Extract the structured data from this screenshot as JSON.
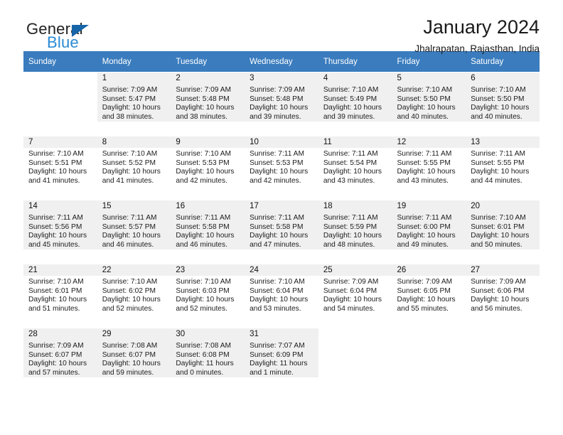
{
  "brand": {
    "name_part1": "General",
    "name_part2": "Blue",
    "triangle_color": "#1565a8",
    "blue_color": "#2a8ad4"
  },
  "header": {
    "title": "January 2024",
    "subtitle": "Jhalrapatan, Rajasthan, India"
  },
  "theme": {
    "header_bg": "#3a7cbe",
    "header_text": "#ffffff",
    "row_shade": "#f0f0f0"
  },
  "weekdays": [
    "Sunday",
    "Monday",
    "Tuesday",
    "Wednesday",
    "Thursday",
    "Friday",
    "Saturday"
  ],
  "labels": {
    "sunrise_prefix": "Sunrise:",
    "sunset_prefix": "Sunset:",
    "daylight_prefix": "Daylight:"
  },
  "weeks": [
    {
      "shaded": true,
      "days": [
        {
          "num": "",
          "sunrise": "",
          "sunset": "",
          "daylight_line1": "",
          "daylight_line2": ""
        },
        {
          "num": "1",
          "sunrise": "Sunrise: 7:09 AM",
          "sunset": "Sunset: 5:47 PM",
          "daylight_line1": "Daylight: 10 hours",
          "daylight_line2": "and 38 minutes."
        },
        {
          "num": "2",
          "sunrise": "Sunrise: 7:09 AM",
          "sunset": "Sunset: 5:48 PM",
          "daylight_line1": "Daylight: 10 hours",
          "daylight_line2": "and 38 minutes."
        },
        {
          "num": "3",
          "sunrise": "Sunrise: 7:09 AM",
          "sunset": "Sunset: 5:48 PM",
          "daylight_line1": "Daylight: 10 hours",
          "daylight_line2": "and 39 minutes."
        },
        {
          "num": "4",
          "sunrise": "Sunrise: 7:10 AM",
          "sunset": "Sunset: 5:49 PM",
          "daylight_line1": "Daylight: 10 hours",
          "daylight_line2": "and 39 minutes."
        },
        {
          "num": "5",
          "sunrise": "Sunrise: 7:10 AM",
          "sunset": "Sunset: 5:50 PM",
          "daylight_line1": "Daylight: 10 hours",
          "daylight_line2": "and 40 minutes."
        },
        {
          "num": "6",
          "sunrise": "Sunrise: 7:10 AM",
          "sunset": "Sunset: 5:50 PM",
          "daylight_line1": "Daylight: 10 hours",
          "daylight_line2": "and 40 minutes."
        }
      ]
    },
    {
      "shaded": false,
      "days": [
        {
          "num": "7",
          "sunrise": "Sunrise: 7:10 AM",
          "sunset": "Sunset: 5:51 PM",
          "daylight_line1": "Daylight: 10 hours",
          "daylight_line2": "and 41 minutes."
        },
        {
          "num": "8",
          "sunrise": "Sunrise: 7:10 AM",
          "sunset": "Sunset: 5:52 PM",
          "daylight_line1": "Daylight: 10 hours",
          "daylight_line2": "and 41 minutes."
        },
        {
          "num": "9",
          "sunrise": "Sunrise: 7:10 AM",
          "sunset": "Sunset: 5:53 PM",
          "daylight_line1": "Daylight: 10 hours",
          "daylight_line2": "and 42 minutes."
        },
        {
          "num": "10",
          "sunrise": "Sunrise: 7:11 AM",
          "sunset": "Sunset: 5:53 PM",
          "daylight_line1": "Daylight: 10 hours",
          "daylight_line2": "and 42 minutes."
        },
        {
          "num": "11",
          "sunrise": "Sunrise: 7:11 AM",
          "sunset": "Sunset: 5:54 PM",
          "daylight_line1": "Daylight: 10 hours",
          "daylight_line2": "and 43 minutes."
        },
        {
          "num": "12",
          "sunrise": "Sunrise: 7:11 AM",
          "sunset": "Sunset: 5:55 PM",
          "daylight_line1": "Daylight: 10 hours",
          "daylight_line2": "and 43 minutes."
        },
        {
          "num": "13",
          "sunrise": "Sunrise: 7:11 AM",
          "sunset": "Sunset: 5:55 PM",
          "daylight_line1": "Daylight: 10 hours",
          "daylight_line2": "and 44 minutes."
        }
      ]
    },
    {
      "shaded": true,
      "days": [
        {
          "num": "14",
          "sunrise": "Sunrise: 7:11 AM",
          "sunset": "Sunset: 5:56 PM",
          "daylight_line1": "Daylight: 10 hours",
          "daylight_line2": "and 45 minutes."
        },
        {
          "num": "15",
          "sunrise": "Sunrise: 7:11 AM",
          "sunset": "Sunset: 5:57 PM",
          "daylight_line1": "Daylight: 10 hours",
          "daylight_line2": "and 46 minutes."
        },
        {
          "num": "16",
          "sunrise": "Sunrise: 7:11 AM",
          "sunset": "Sunset: 5:58 PM",
          "daylight_line1": "Daylight: 10 hours",
          "daylight_line2": "and 46 minutes."
        },
        {
          "num": "17",
          "sunrise": "Sunrise: 7:11 AM",
          "sunset": "Sunset: 5:58 PM",
          "daylight_line1": "Daylight: 10 hours",
          "daylight_line2": "and 47 minutes."
        },
        {
          "num": "18",
          "sunrise": "Sunrise: 7:11 AM",
          "sunset": "Sunset: 5:59 PM",
          "daylight_line1": "Daylight: 10 hours",
          "daylight_line2": "and 48 minutes."
        },
        {
          "num": "19",
          "sunrise": "Sunrise: 7:11 AM",
          "sunset": "Sunset: 6:00 PM",
          "daylight_line1": "Daylight: 10 hours",
          "daylight_line2": "and 49 minutes."
        },
        {
          "num": "20",
          "sunrise": "Sunrise: 7:10 AM",
          "sunset": "Sunset: 6:01 PM",
          "daylight_line1": "Daylight: 10 hours",
          "daylight_line2": "and 50 minutes."
        }
      ]
    },
    {
      "shaded": false,
      "days": [
        {
          "num": "21",
          "sunrise": "Sunrise: 7:10 AM",
          "sunset": "Sunset: 6:01 PM",
          "daylight_line1": "Daylight: 10 hours",
          "daylight_line2": "and 51 minutes."
        },
        {
          "num": "22",
          "sunrise": "Sunrise: 7:10 AM",
          "sunset": "Sunset: 6:02 PM",
          "daylight_line1": "Daylight: 10 hours",
          "daylight_line2": "and 52 minutes."
        },
        {
          "num": "23",
          "sunrise": "Sunrise: 7:10 AM",
          "sunset": "Sunset: 6:03 PM",
          "daylight_line1": "Daylight: 10 hours",
          "daylight_line2": "and 52 minutes."
        },
        {
          "num": "24",
          "sunrise": "Sunrise: 7:10 AM",
          "sunset": "Sunset: 6:04 PM",
          "daylight_line1": "Daylight: 10 hours",
          "daylight_line2": "and 53 minutes."
        },
        {
          "num": "25",
          "sunrise": "Sunrise: 7:09 AM",
          "sunset": "Sunset: 6:04 PM",
          "daylight_line1": "Daylight: 10 hours",
          "daylight_line2": "and 54 minutes."
        },
        {
          "num": "26",
          "sunrise": "Sunrise: 7:09 AM",
          "sunset": "Sunset: 6:05 PM",
          "daylight_line1": "Daylight: 10 hours",
          "daylight_line2": "and 55 minutes."
        },
        {
          "num": "27",
          "sunrise": "Sunrise: 7:09 AM",
          "sunset": "Sunset: 6:06 PM",
          "daylight_line1": "Daylight: 10 hours",
          "daylight_line2": "and 56 minutes."
        }
      ]
    },
    {
      "shaded": true,
      "days": [
        {
          "num": "28",
          "sunrise": "Sunrise: 7:09 AM",
          "sunset": "Sunset: 6:07 PM",
          "daylight_line1": "Daylight: 10 hours",
          "daylight_line2": "and 57 minutes."
        },
        {
          "num": "29",
          "sunrise": "Sunrise: 7:08 AM",
          "sunset": "Sunset: 6:07 PM",
          "daylight_line1": "Daylight: 10 hours",
          "daylight_line2": "and 59 minutes."
        },
        {
          "num": "30",
          "sunrise": "Sunrise: 7:08 AM",
          "sunset": "Sunset: 6:08 PM",
          "daylight_line1": "Daylight: 11 hours",
          "daylight_line2": "and 0 minutes."
        },
        {
          "num": "31",
          "sunrise": "Sunrise: 7:07 AM",
          "sunset": "Sunset: 6:09 PM",
          "daylight_line1": "Daylight: 11 hours",
          "daylight_line2": "and 1 minute."
        },
        {
          "num": "",
          "sunrise": "",
          "sunset": "",
          "daylight_line1": "",
          "daylight_line2": ""
        },
        {
          "num": "",
          "sunrise": "",
          "sunset": "",
          "daylight_line1": "",
          "daylight_line2": ""
        },
        {
          "num": "",
          "sunrise": "",
          "sunset": "",
          "daylight_line1": "",
          "daylight_line2": ""
        }
      ]
    }
  ]
}
